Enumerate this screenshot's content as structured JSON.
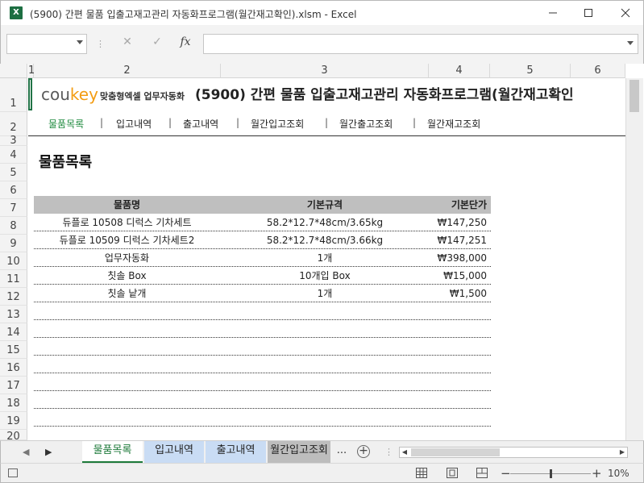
{
  "window": {
    "title": "(5900) 간편 물품 입출고재고관리 자동화프로그램(월간재고확인).xlsm  -  Excel",
    "app_icon": "X"
  },
  "columns": [
    "1",
    "2",
    "3",
    "4",
    "5",
    "6"
  ],
  "rows": [
    "1",
    "2",
    "3",
    "4",
    "5",
    "6",
    "7",
    "8",
    "9",
    "10",
    "11",
    "12",
    "13",
    "14",
    "15",
    "16",
    "17",
    "18",
    "19",
    "20"
  ],
  "sheet": {
    "logo_main": "cou",
    "logo_accent": "key",
    "logo_sub": "맞춤형엑셀 업무자동화",
    "title": "(5900) 간편 물품 입출고재고관리 자동화프로그램(월간재고확인",
    "nav": [
      "물품목록",
      "입고내역",
      "출고내역",
      "월간입고조회",
      "월간출고조회",
      "월간재고조회"
    ],
    "nav_separator": "|",
    "section_title": "물품목록",
    "table": {
      "headers": [
        "물품명",
        "기본규격",
        "기본단가"
      ],
      "rows": [
        [
          "듀플로 10508 디럭스 기차세트",
          "58.2*12.7*48cm/3.65kg",
          "₩147,250"
        ],
        [
          "듀플로 10509 디럭스 기차세트2",
          "58.2*12.7*48cm/3.66kg",
          "₩147,251"
        ],
        [
          "업무자동화",
          "1개",
          "₩398,000"
        ],
        [
          "칫솔 Box",
          "10개입 Box",
          "₩15,000"
        ],
        [
          "칫솔 낱개",
          "1개",
          "₩1,500"
        ],
        [
          "",
          "",
          ""
        ],
        [
          "",
          "",
          ""
        ],
        [
          "",
          "",
          ""
        ],
        [
          "",
          "",
          ""
        ],
        [
          "",
          "",
          ""
        ],
        [
          "",
          "",
          ""
        ],
        [
          "",
          "",
          ""
        ],
        [
          "",
          "",
          ""
        ]
      ]
    }
  },
  "tabs": [
    {
      "label": "물품목록",
      "style": "active"
    },
    {
      "label": "입고내역",
      "style": "blue"
    },
    {
      "label": "출고내역",
      "style": "blue"
    },
    {
      "label": "월간입고조회",
      "style": "gray"
    }
  ],
  "tab_overflow": "...",
  "status": {
    "zoom": "10%"
  },
  "colors": {
    "excel_green": "#217346",
    "accent_orange": "#f39c12",
    "active_nav": "#1e8a3e"
  }
}
